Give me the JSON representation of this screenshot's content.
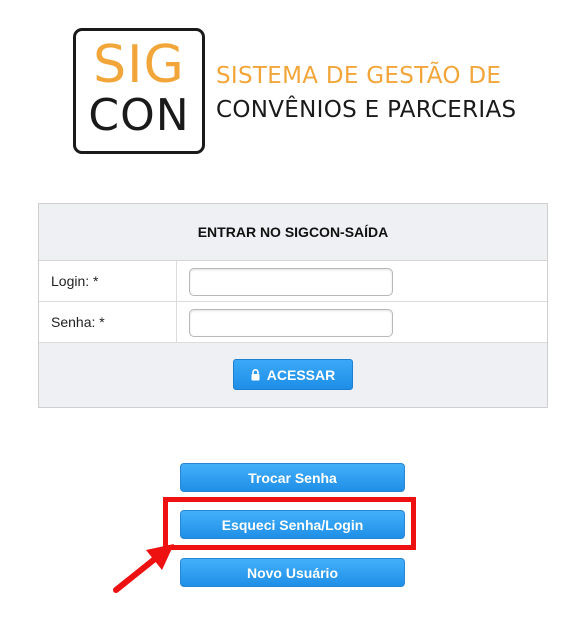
{
  "logo": {
    "sig": "SIG",
    "con": "CON",
    "line1": "SISTEMA DE GESTÃO DE",
    "line2": "CONVÊNIOS E PARCERIAS",
    "colors": {
      "accent": "#f2a63a",
      "dark": "#1a1a1a"
    }
  },
  "login_panel": {
    "title": "ENTRAR NO SIGCON-SAÍDA",
    "login_label": "Login: *",
    "login_value": "",
    "senha_label": "Senha: *",
    "senha_value": "",
    "submit_label": "ACESSAR",
    "submit_icon": "lock-icon"
  },
  "actions": {
    "trocar_senha": "Trocar Senha",
    "esqueci_senha": "Esqueci Senha/Login",
    "novo_usuario": "Novo Usuário"
  },
  "annotation": {
    "highlight_color": "#ee1111",
    "arrow_icon": "arrow-icon"
  },
  "colors": {
    "button_blue": "#1e8ee8",
    "panel_bg": "#eef0f3"
  }
}
